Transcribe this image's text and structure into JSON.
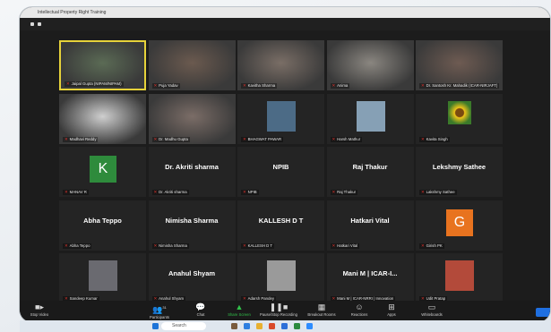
{
  "window_title": "Intellectual Property Right Training",
  "tiles": [
    {
      "name": "Jaipal Gupta (NIPAM/NIPAM)",
      "big": "",
      "kind": "video",
      "tone": "#5b6b55",
      "active": true
    },
    {
      "name": "Puja Yadav",
      "big": "",
      "kind": "video",
      "tone": "#6b5a4f"
    },
    {
      "name": "Kavitha Sharma",
      "big": "",
      "kind": "video",
      "tone": "#7a6e66"
    },
    {
      "name": "Anima",
      "big": "",
      "kind": "video",
      "tone": "#8a8680"
    },
    {
      "name": "Dr. Santosh Kr. Mahadik (ICAR-NIRJAFT)",
      "big": "",
      "kind": "video",
      "tone": "#6e5b52"
    },
    {
      "name": "Madhavi Reddy",
      "big": "",
      "kind": "video",
      "tone": "#cfcfcf"
    },
    {
      "name": "Dr. Madhu Gupta",
      "big": "",
      "kind": "video",
      "tone": "#7b6d67"
    },
    {
      "name": "BHAGWAT PAWAR",
      "big": "",
      "kind": "photo",
      "tone": "#4c6b86"
    },
    {
      "name": "Harsh Mathur",
      "big": "",
      "kind": "photo",
      "tone": "#86a0b5"
    },
    {
      "name": "Kavita Singh",
      "big": "",
      "kind": "flower",
      "tone": "#f0c419"
    },
    {
      "name": "MANAV R",
      "big": "",
      "kind": "avatar",
      "letter": "K",
      "tone": "#2e8b3c"
    },
    {
      "name": "Dr. Akriti sharma",
      "big": "Dr. Akriti sharma",
      "kind": "text"
    },
    {
      "name": "NPIB",
      "big": "NPIB",
      "kind": "text"
    },
    {
      "name": "Raj Thakur",
      "big": "Raj Thakur",
      "kind": "text"
    },
    {
      "name": "Lakshmy Sathee",
      "big": "Lekshmy Sathee",
      "kind": "text"
    },
    {
      "name": "Abha Teppo",
      "big": "Abha Teppo",
      "kind": "text"
    },
    {
      "name": "Nimisha Sharma",
      "big": "Nimisha Sharma",
      "kind": "text"
    },
    {
      "name": "KALLESH D T",
      "big": "KALLESH D T",
      "kind": "text"
    },
    {
      "name": "Hatkari Vital",
      "big": "Hatkari Vital",
      "kind": "text"
    },
    {
      "name": "Girish PK",
      "big": "",
      "kind": "avatar",
      "letter": "G",
      "tone": "#e8731f"
    },
    {
      "name": "Sandeep Kumar",
      "big": "",
      "kind": "photo",
      "tone": "#6a6a70"
    },
    {
      "name": "Anahul Shyam",
      "big": "Anahul Shyam",
      "kind": "text"
    },
    {
      "name": "Adarsh Pandey",
      "big": "",
      "kind": "photo",
      "tone": "#9a9a9a"
    },
    {
      "name": "Mani M | ICAR-NRRI | Innovation",
      "big": "Mani M | ICAR-I...",
      "kind": "text"
    },
    {
      "name": "Udit Pratap",
      "big": "",
      "kind": "photo",
      "tone": "#b34a3a"
    }
  ],
  "toolbar": {
    "stop_video": "Stop Video",
    "participants": "Participants",
    "participants_count": "31",
    "chat": "Chat",
    "share_screen": "Share Screen",
    "record": "Pause/Stop Recording",
    "breakout": "Breakout Rooms",
    "reactions": "Reactions",
    "apps": "Apps",
    "whiteboard": "Whiteboards"
  },
  "taskbar": {
    "search_placeholder": "Search"
  }
}
